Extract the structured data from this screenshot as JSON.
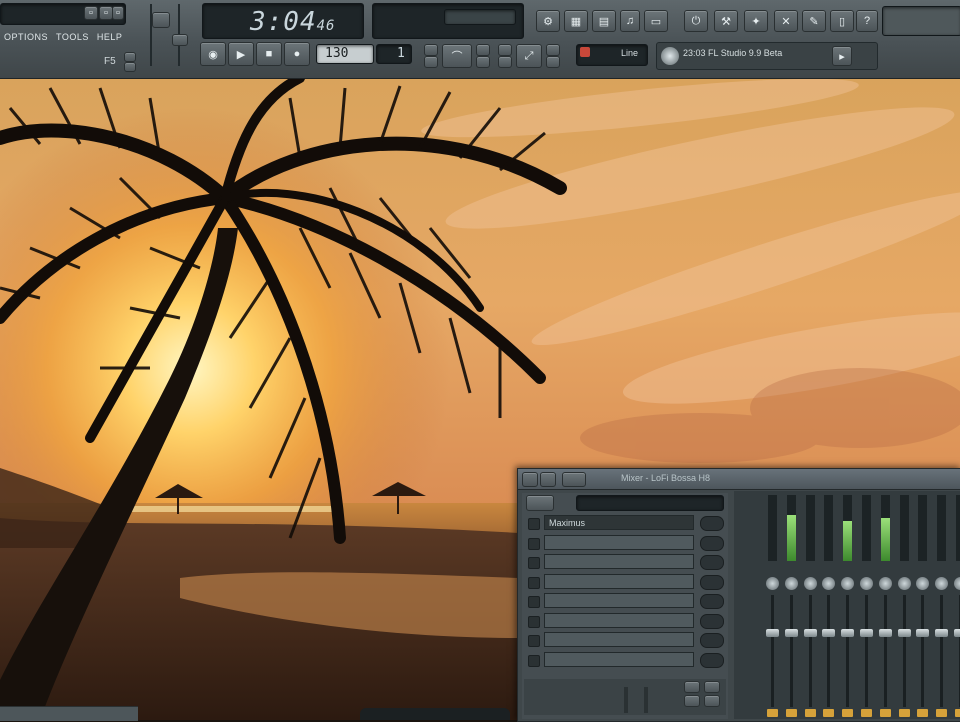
{
  "app": {
    "window_title": "23:03 FL Studio 9.9 Beta",
    "clock": {
      "main": "3:04",
      "sub": "46"
    },
    "menu": [
      "OPTIONS",
      "TOOLS",
      "HELP"
    ],
    "f5_label": "F5",
    "tempo": "130",
    "pattern": "1",
    "line_label": "Line"
  },
  "transport": [
    {
      "name": "record-button",
      "glyph": "●"
    },
    {
      "name": "play-button",
      "glyph": "▶"
    },
    {
      "name": "stop-button",
      "glyph": "■"
    },
    {
      "name": "loop-button",
      "glyph": "●"
    }
  ],
  "mixer": {
    "title": "Mixer - LoFi Bossa H8",
    "fx_slots": [
      "Maximus",
      "",
      "",
      "",
      "",
      "",
      "",
      ""
    ],
    "strip_levels": [
      0.0,
      0.7,
      0.0,
      0.0,
      0.6,
      0.0,
      0.65,
      0.0,
      0.0,
      0.0,
      0.0,
      0.0
    ],
    "fader_levels": [
      0.3,
      0.3,
      0.3,
      0.3,
      0.3,
      0.3,
      0.3,
      0.3,
      0.3,
      0.3,
      0.3,
      0.3
    ]
  },
  "colors": {
    "toolbar": "#4a5256",
    "clock_text": "#c9d6dc",
    "meter_green": "#9be07a",
    "strip_led": "#d6a23a"
  }
}
